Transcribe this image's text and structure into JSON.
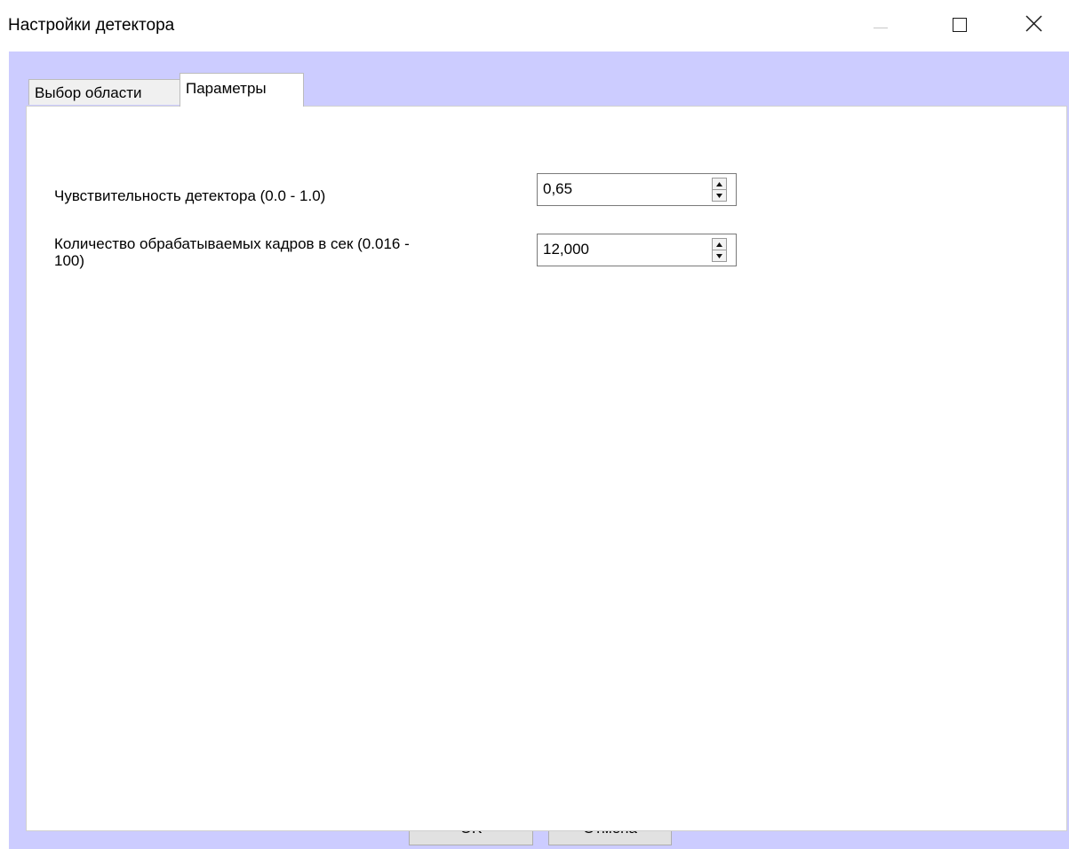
{
  "window": {
    "title": "Настройки детектора",
    "controls": {
      "minimize_icon": "minimize-icon",
      "maximize_icon": "maximize-icon",
      "close_icon": "close-icon"
    }
  },
  "tabs": [
    {
      "label": "Выбор области",
      "active": false
    },
    {
      "label": "Параметры",
      "active": true
    }
  ],
  "parameters": {
    "sensitivity": {
      "label": "Чувствительность детектора (0.0 - 1.0)",
      "value": "0,65"
    },
    "frame_rate": {
      "label": "Количество обрабатываемых кадров в сек (0.016 - 100)",
      "value": "12,000"
    }
  },
  "buttons": {
    "ok": "OK",
    "cancel": "Отмена"
  },
  "colors": {
    "client_background": "#ccccff",
    "panel_background": "#ffffff",
    "button_background": "#e1e1e1"
  }
}
